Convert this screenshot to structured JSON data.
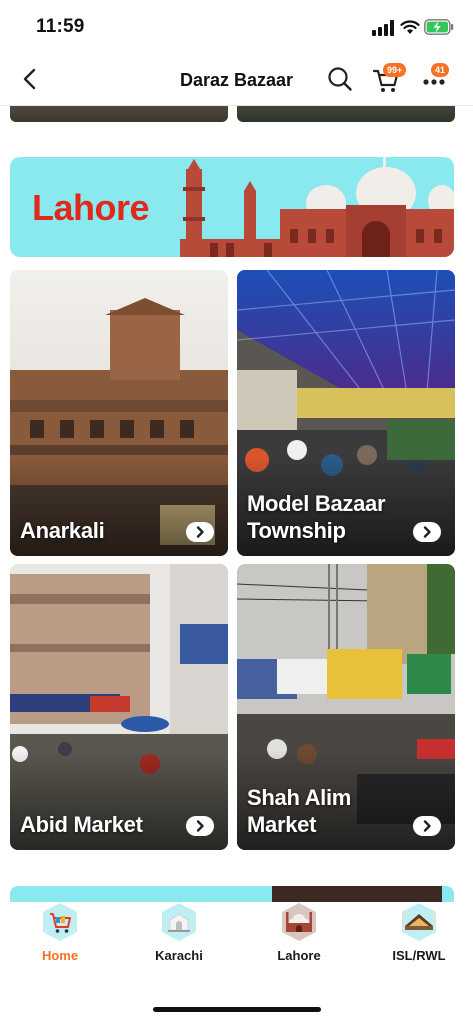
{
  "status_bar": {
    "time": "11:59"
  },
  "header": {
    "title": "Daraz Bazaar",
    "cart_badge": "99+",
    "more_badge": "41"
  },
  "banner": {
    "city": "Lahore"
  },
  "markets": [
    {
      "name": "Anarkali"
    },
    {
      "name": "Model Bazaar Township"
    },
    {
      "name": "Abid Market"
    },
    {
      "name": "Shah Alim Market"
    }
  ],
  "tabs": [
    {
      "label": "Home",
      "active": true,
      "icon": "cart-icon"
    },
    {
      "label": "Karachi",
      "active": false,
      "icon": "mausoleum-icon"
    },
    {
      "label": "Lahore",
      "active": false,
      "icon": "mosque-icon"
    },
    {
      "label": "ISL/RWL",
      "active": false,
      "icon": "faisal-mosque-icon"
    }
  ],
  "colors": {
    "accent": "#f57224",
    "banner_bg": "#8ae8ef",
    "banner_text": "#e0281b"
  }
}
